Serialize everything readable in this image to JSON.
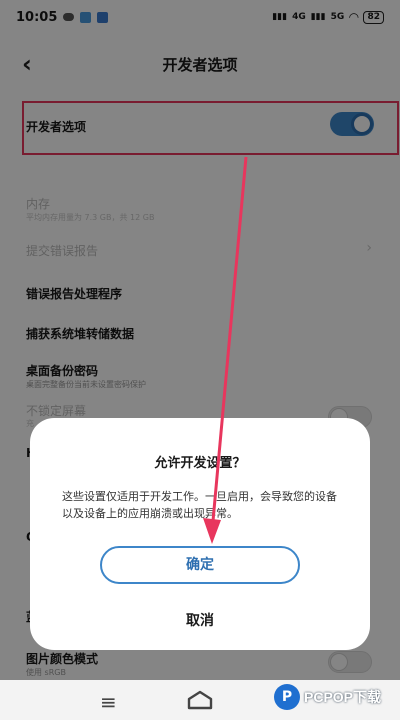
{
  "status_bar": {
    "time": "10:05",
    "network_1": "4G",
    "network_2": "5G",
    "battery": "82"
  },
  "header": {
    "back_symbol": "‹",
    "title": "开发者选项"
  },
  "settings": {
    "developer_options": {
      "label": "开发者选项",
      "enabled": true
    },
    "memory": {
      "label": "内存",
      "subtitle": "平均内存用量为 7.3 GB，共 12 GB"
    },
    "submit_bug_report": {
      "label": "提交错误报告"
    },
    "bug_report_handler": {
      "label": "错误报告处理程序"
    },
    "capture_heap_dump": {
      "label": "捕获系统堆转储数据"
    },
    "desktop_backup_password": {
      "label": "桌面备份密码",
      "subtitle": "桌面完整备份当前未设置密码保护"
    },
    "stay_awake": {
      "label": "不锁定屏幕",
      "subtitle": "充"
    },
    "partial_rows": [
      "H",
      "O",
      "蓝"
    ],
    "color_mode": {
      "label": "图片颜色模式",
      "subtitle": "使用 sRGB"
    }
  },
  "dialog": {
    "title": "允许开发设置？",
    "message": "这些设置仅适用于开发工作。一旦启用，会导致您的设备以及设备上的应用崩溃或出现异常。",
    "confirm_label": "确定",
    "cancel_label": "取消"
  },
  "nav_bar": {
    "menu_symbol": "≡"
  },
  "watermark": {
    "logo_letter": "P",
    "text": "PCPOP下载"
  },
  "colors": {
    "accent": "#3d86c9",
    "highlight_annotation": "#e8365d"
  }
}
